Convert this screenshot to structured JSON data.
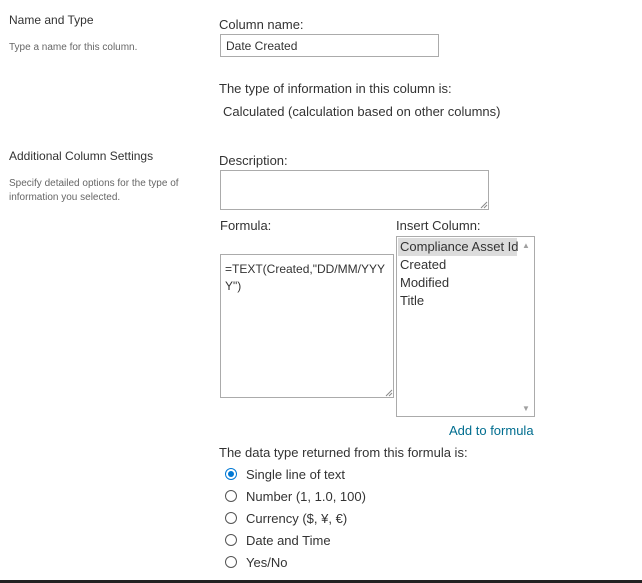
{
  "name_and_type": {
    "title": "Name and Type",
    "description": "Type a name for this column."
  },
  "column_name": {
    "label": "Column name:",
    "value": "Date Created"
  },
  "type_info": {
    "label": "The type of information in this column is:",
    "value": "Calculated (calculation based on other columns)"
  },
  "additional_settings": {
    "title": "Additional Column Settings",
    "description": "Specify detailed options for the type of information you selected."
  },
  "description_field": {
    "label": "Description:",
    "value": ""
  },
  "formula": {
    "label": "Formula:",
    "value": "=TEXT(Created,\"DD/MM/YYYY\")"
  },
  "insert_column": {
    "label": "Insert Column:",
    "items": [
      "Compliance Asset Id",
      "Created",
      "Modified",
      "Title"
    ],
    "selected_index": 0,
    "add_link": "Add to formula"
  },
  "return_type": {
    "label": "The data type returned from this formula is:",
    "options": [
      {
        "label": "Single line of text",
        "checked": true
      },
      {
        "label": "Number (1, 1.0, 100)",
        "checked": false
      },
      {
        "label": "Currency ($, ¥, €)",
        "checked": false
      },
      {
        "label": "Date and Time",
        "checked": false
      },
      {
        "label": "Yes/No",
        "checked": false
      }
    ]
  },
  "colors": {
    "link": "#006d8f",
    "radio_accent": "#0078d4",
    "selected_item_bg": "#dcdcdc"
  }
}
